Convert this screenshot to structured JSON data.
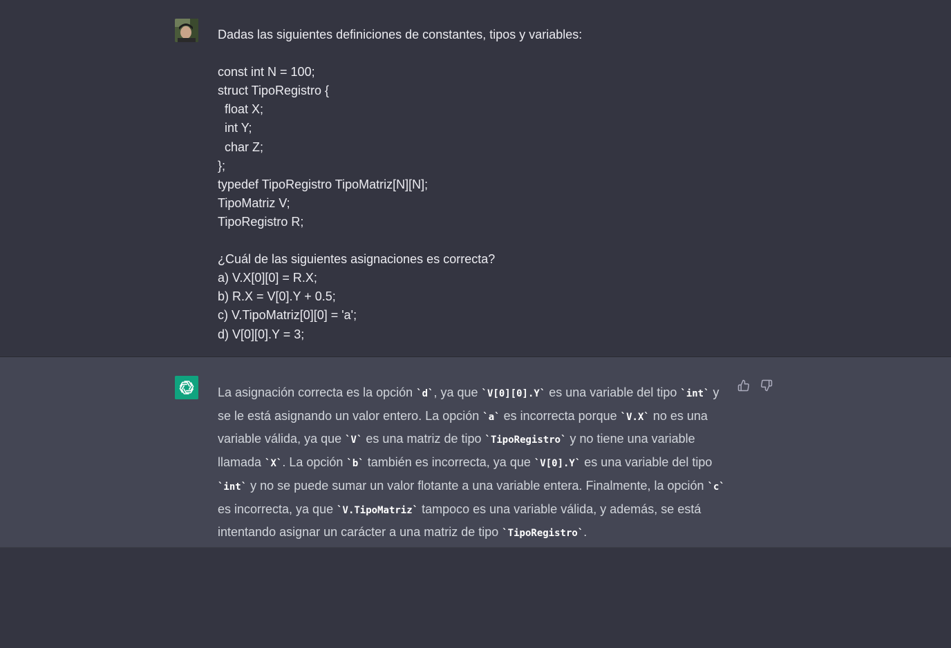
{
  "conversation": {
    "user_message": {
      "lines": [
        "Dadas las siguientes definiciones de constantes, tipos y variables:",
        "",
        "const int N = 100;",
        "struct TipoRegistro {",
        "  float X;",
        "  int Y;",
        "  char Z;",
        "};",
        "typedef TipoRegistro TipoMatriz[N][N];",
        "TipoMatriz V;",
        "TipoRegistro R;",
        "",
        "¿Cuál de las siguientes asignaciones es correcta?",
        "a) V.X[0][0] = R.X;",
        "b) R.X = V[0].Y + 0.5;",
        "c) V.TipoMatriz[0][0] = 'a';",
        "d) V[0][0].Y = 3;"
      ]
    },
    "assistant_message": {
      "segments": [
        {
          "t": "text",
          "v": "La asignación correcta es la opción "
        },
        {
          "t": "code",
          "v": "`d`"
        },
        {
          "t": "text",
          "v": ", ya que "
        },
        {
          "t": "code",
          "v": "`V[0][0].Y`"
        },
        {
          "t": "text",
          "v": " es una variable del tipo "
        },
        {
          "t": "code",
          "v": "`int`"
        },
        {
          "t": "text",
          "v": " y se le está asignando un valor entero. La opción "
        },
        {
          "t": "code",
          "v": "`a`"
        },
        {
          "t": "text",
          "v": " es incorrecta porque "
        },
        {
          "t": "code",
          "v": "`V.X`"
        },
        {
          "t": "text",
          "v": " no es una variable válida, ya que "
        },
        {
          "t": "code",
          "v": "`V`"
        },
        {
          "t": "text",
          "v": " es una matriz de tipo "
        },
        {
          "t": "code",
          "v": "`TipoRegistro`"
        },
        {
          "t": "text",
          "v": " y no tiene una variable llamada "
        },
        {
          "t": "code",
          "v": "`X`"
        },
        {
          "t": "text",
          "v": ". La opción "
        },
        {
          "t": "code",
          "v": "`b`"
        },
        {
          "t": "text",
          "v": " también es incorrecta, ya que "
        },
        {
          "t": "code",
          "v": "`V[0].Y`"
        },
        {
          "t": "text",
          "v": " es una variable del tipo "
        },
        {
          "t": "code",
          "v": "`int`"
        },
        {
          "t": "text",
          "v": " y no se puede sumar un valor flotante a una variable entera. Finalmente, la opción "
        },
        {
          "t": "code",
          "v": "`c`"
        },
        {
          "t": "text",
          "v": " es incorrecta, ya que "
        },
        {
          "t": "code",
          "v": "`V.TipoMatriz`"
        },
        {
          "t": "text",
          "v": " tampoco es una variable válida, y además, se está intentando asignar un carácter a una matriz de tipo "
        },
        {
          "t": "code",
          "v": "`TipoRegistro`"
        },
        {
          "t": "text",
          "v": "."
        }
      ],
      "icons": {
        "avatar": "openai-logo-icon",
        "thumbs_up": "thumbs-up-icon",
        "thumbs_down": "thumbs-down-icon"
      }
    }
  },
  "colors": {
    "page_bg": "#343541",
    "assistant_bg": "#444654",
    "assistant_avatar_bg": "#10a37f",
    "text": "#ececf1",
    "muted_icon": "#acacbe"
  }
}
